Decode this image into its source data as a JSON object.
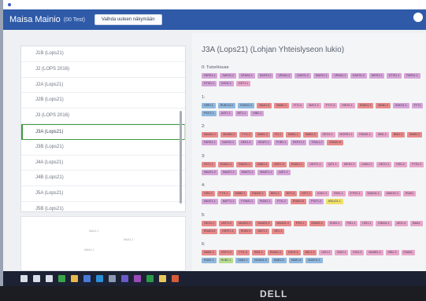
{
  "browser": {
    "url": ""
  },
  "header": {
    "title": "Maisa Mainio",
    "subtitle": "(00 Test)",
    "switch_button": "Vaihda uuteen näkymään"
  },
  "course_list": [
    {
      "label": "J1B (Lops21)",
      "selected": false
    },
    {
      "label": "J2 (LOPS 2016)",
      "selected": false
    },
    {
      "label": "J2A (Lops21)",
      "selected": false
    },
    {
      "label": "J2B (Lops21)",
      "selected": false
    },
    {
      "label": "J3 (LOPS 2016)",
      "selected": false
    },
    {
      "label": "J3A (Lops21)",
      "selected": true
    },
    {
      "label": "J3B (Lops21)",
      "selected": false
    },
    {
      "label": "J4A (Lops21)",
      "selected": false
    },
    {
      "label": "J4B (Lops21)",
      "selected": false
    },
    {
      "label": "J5A (Lops21)",
      "selected": false
    },
    {
      "label": "J5B (Lops21)",
      "selected": false
    }
  ],
  "mini_map": {
    "labels": [
      "MAA1.1",
      "MAA1.1",
      "MAA1.1"
    ]
  },
  "detail": {
    "title": "J3A (Lops21) (Lohjan Yhteislyseon lukio)",
    "groups": [
      {
        "heading": "0: TutorHouse",
        "rows": [
          [
            {
              "code": "FARS1.1",
              "color": "#d6a4d8"
            },
            {
              "code": "SAKS1.2",
              "color": "#d6a4d8"
            },
            {
              "code": "VENA1.1",
              "color": "#d6a4d8"
            },
            {
              "code": "SAKS1.2",
              "color": "#d6a4d8"
            },
            {
              "code": "VENA1.2",
              "color": "#d6a4d8"
            },
            {
              "code": "SAKS1.2",
              "color": "#d6a4d8"
            },
            {
              "code": "SAKS1.1",
              "color": "#d6a4d8"
            },
            {
              "code": "VENA1.1",
              "color": "#d6a4d8"
            },
            {
              "code": "EAKS1.2",
              "color": "#d6a4d8"
            },
            {
              "code": "HIES1.1",
              "color": "#d6a4d8"
            },
            {
              "code": "ETIS1.1",
              "color": "#d6a4d8"
            },
            {
              "code": "FARS1.1",
              "color": "#d6a4d8"
            }
          ],
          [
            {
              "code": "ETIS1.1",
              "color": "#d6a4d8"
            },
            {
              "code": "DOS1.1",
              "color": "#d6a4d8"
            },
            {
              "code": "GET1.1",
              "color": "#e7a6c9"
            }
          ]
        ]
      },
      {
        "heading": "1:",
        "rows": [
          [
            {
              "code": "HIRH.1",
              "color": "#8fb8dd"
            },
            {
              "code": "RUB113.2",
              "color": "#8fb8dd"
            },
            {
              "code": "RUM12.2",
              "color": "#8fb8dd"
            },
            {
              "code": "MAA1.4",
              "color": "#e88a8a"
            },
            {
              "code": "MAB1.1",
              "color": "#e88a8a"
            },
            {
              "code": "FIT1.4",
              "color": "#e7a6c9"
            },
            {
              "code": "MAT1.2",
              "color": "#e7a6c9"
            },
            {
              "code": "FYT1.3",
              "color": "#e7a6c9"
            },
            {
              "code": "HIES1.1",
              "color": "#e7a6c9"
            },
            {
              "code": "ENA01.1",
              "color": "#e88a8a"
            },
            {
              "code": "MAB1.2",
              "color": "#e88a8a"
            },
            {
              "code": "SAKS1.1",
              "color": "#d6a4d8"
            },
            {
              "code": "FYT1",
              "color": "#d6a4d8"
            }
          ],
          [
            {
              "code": "PSI71.1",
              "color": "#8fb8dd"
            },
            {
              "code": "AAT1.1",
              "color": "#d6a4d8"
            },
            {
              "code": "BIT1.1",
              "color": "#d6a4d8"
            },
            {
              "code": "HIB1.1",
              "color": "#d6a4d8"
            }
          ]
        ]
      },
      {
        "heading": "2:",
        "rows": [
          [
            {
              "code": "MAAK1.1",
              "color": "#e88a8a"
            },
            {
              "code": "MAAB1.2",
              "color": "#e88a8a"
            },
            {
              "code": "FYI1.2",
              "color": "#e88a8a"
            },
            {
              "code": "MAB1.2",
              "color": "#e88a8a"
            },
            {
              "code": "FI1.1",
              "color": "#e88a8a"
            },
            {
              "code": "MAB1.1",
              "color": "#e88a8a"
            },
            {
              "code": "MAB1.3",
              "color": "#e88a8a"
            },
            {
              "code": "GEO1.1",
              "color": "#e7a6c9"
            },
            {
              "code": "MORS1.1",
              "color": "#e7a6c9"
            },
            {
              "code": "ENA01.1",
              "color": "#e7a6c9"
            },
            {
              "code": "HIB1.1",
              "color": "#e7a6c9"
            },
            {
              "code": "BIM1.1",
              "color": "#e88a8a"
            },
            {
              "code": "MAB1.2",
              "color": "#e88a8a"
            }
          ],
          [
            {
              "code": "FARS1.1",
              "color": "#d6a4d8"
            },
            {
              "code": "EAKS1.1",
              "color": "#d6a4d8"
            },
            {
              "code": "GEK1.1",
              "color": "#d6a4d8"
            },
            {
              "code": "UEAT1.1",
              "color": "#d6a4d8"
            },
            {
              "code": "FHB1.1",
              "color": "#d6a4d8"
            },
            {
              "code": "KEST1.2",
              "color": "#d6a4d8"
            },
            {
              "code": "TEAL1.2",
              "color": "#d6a4d8"
            },
            {
              "code": "ENA01.6",
              "color": "#e88a8a"
            }
          ]
        ]
      },
      {
        "heading": "3:",
        "rows": [
          [
            {
              "code": "FKT1.1",
              "color": "#e88a8a"
            },
            {
              "code": "ENA01.1",
              "color": "#e88a8a"
            },
            {
              "code": "ENA01.1",
              "color": "#e88a8a"
            },
            {
              "code": "MAB1.4",
              "color": "#e88a8a"
            },
            {
              "code": "MAT1.3",
              "color": "#e88a8a"
            },
            {
              "code": "ENA01.1",
              "color": "#e88a8a"
            },
            {
              "code": "UEST1.1",
              "color": "#e7a6c9"
            },
            {
              "code": "QIT1.1",
              "color": "#e7a6c9"
            },
            {
              "code": "HIES1.1",
              "color": "#e7a6c9"
            },
            {
              "code": "LIAN1.1",
              "color": "#e7a6c9"
            },
            {
              "code": "GEO1.1",
              "color": "#e7a6c9"
            },
            {
              "code": "HIS1.2",
              "color": "#e7a6c9"
            },
            {
              "code": "FYS1.2",
              "color": "#e7a6c9"
            }
          ],
          [
            {
              "code": "MAAY1.2",
              "color": "#d6a4d8"
            },
            {
              "code": "MAAT1.2",
              "color": "#d6a4d8"
            },
            {
              "code": "MAAT1.1",
              "color": "#d6a4d8"
            },
            {
              "code": "MAAT1.1",
              "color": "#d6a4d8"
            },
            {
              "code": "AAT1.1",
              "color": "#d6a4d8"
            }
          ]
        ]
      },
      {
        "heading": "4:",
        "rows": [
          [
            {
              "code": "HIS1.1",
              "color": "#e88a8a"
            },
            {
              "code": "FYI1.1",
              "color": "#e88a8a"
            },
            {
              "code": "MAB0.1",
              "color": "#e88a8a"
            },
            {
              "code": "ENA01.1",
              "color": "#e88a8a"
            },
            {
              "code": "BIA1.1",
              "color": "#e88a8a"
            },
            {
              "code": "BIT1.4",
              "color": "#e88a8a"
            },
            {
              "code": "HIT1.1",
              "color": "#e88a8a"
            },
            {
              "code": "KAK1.1",
              "color": "#e7a6c9"
            },
            {
              "code": "EMI1.1",
              "color": "#e7a6c9"
            },
            {
              "code": "ETIS1.1",
              "color": "#e7a6c9"
            },
            {
              "code": "MAAS1.1",
              "color": "#e7a6c9"
            },
            {
              "code": "MAKS1.1",
              "color": "#e7a6c9"
            },
            {
              "code": "RUM1",
              "color": "#e7a6c9"
            }
          ],
          [
            {
              "code": "MAAT1.1",
              "color": "#d6a4d8"
            },
            {
              "code": "MATT1.1",
              "color": "#d6a4d8"
            },
            {
              "code": "FYAM1.1",
              "color": "#d6a4d8"
            },
            {
              "code": "RUM1.1",
              "color": "#d6a4d8"
            },
            {
              "code": "FYI1.2",
              "color": "#d6a4d8"
            },
            {
              "code": "ENA01.6",
              "color": "#e88a8a"
            },
            {
              "code": "PSI71.2",
              "color": "#d6a4d8"
            },
            {
              "code": "MSUO1.1",
              "color": "#eee06a"
            }
          ]
        ]
      },
      {
        "heading": "5:",
        "rows": [
          [
            {
              "code": "GEO1.1",
              "color": "#e88a8a"
            },
            {
              "code": "UEIT1.2",
              "color": "#e88a8a"
            },
            {
              "code": "MAAS1.2",
              "color": "#e88a8a"
            },
            {
              "code": "MAAS1.2",
              "color": "#e88a8a"
            },
            {
              "code": "MAAS1.4",
              "color": "#e88a8a"
            },
            {
              "code": "PSI1.1",
              "color": "#e88a8a"
            },
            {
              "code": "ENA01.1",
              "color": "#e88a8a"
            },
            {
              "code": "RUB1.1",
              "color": "#e7a6c9"
            },
            {
              "code": "PSI1.1",
              "color": "#e7a6c9"
            },
            {
              "code": "HIS1.1",
              "color": "#e7a6c9"
            },
            {
              "code": "ENA01.1",
              "color": "#e7a6c9"
            },
            {
              "code": "UEI1.4",
              "color": "#e7a6c9"
            },
            {
              "code": "MAA1",
              "color": "#e7a6c9"
            }
          ],
          [
            {
              "code": "ENA01.6",
              "color": "#e88a8a"
            },
            {
              "code": "KEST1.1",
              "color": "#e88a8a"
            },
            {
              "code": "RUB1.5",
              "color": "#e88a8a"
            },
            {
              "code": "AAT1.1",
              "color": "#e88a8a"
            },
            {
              "code": "GE1.1",
              "color": "#e88a8a"
            }
          ]
        ]
      },
      {
        "heading": "6:",
        "rows": [
          [
            {
              "code": "MAB1.1",
              "color": "#e88a8a"
            },
            {
              "code": "GEIT1.2",
              "color": "#e88a8a"
            },
            {
              "code": "FYI1.3",
              "color": "#e88a8a"
            },
            {
              "code": "HIB1.1",
              "color": "#e88a8a"
            },
            {
              "code": "ENA01.1",
              "color": "#e88a8a"
            },
            {
              "code": "KEH1.4",
              "color": "#e88a8a"
            },
            {
              "code": "AEL1.1",
              "color": "#e88a8a"
            },
            {
              "code": "UEI1.2",
              "color": "#e7a6c9"
            },
            {
              "code": "BIU2.1",
              "color": "#e7a6c9"
            },
            {
              "code": "HIS1.2",
              "color": "#e7a6c9"
            },
            {
              "code": "MAAB1.2",
              "color": "#e7a6c9"
            },
            {
              "code": "HIB1.2",
              "color": "#e7a6c9"
            },
            {
              "code": "ENA01",
              "color": "#e7a6c9"
            }
          ],
          [
            {
              "code": "RUB1.1",
              "color": "#8fb8dd"
            },
            {
              "code": "RUB1.1",
              "color": "#b6dd8f"
            },
            {
              "code": "SAB1.1",
              "color": "#8fb8dd"
            },
            {
              "code": "MAAN1.5",
              "color": "#8fb8dd"
            },
            {
              "code": "MAB1.5",
              "color": "#8fb8dd"
            },
            {
              "code": "MAB1.6",
              "color": "#8fb8dd"
            },
            {
              "code": "MAEH1.1",
              "color": "#8fb8dd"
            }
          ]
        ]
      }
    ]
  },
  "taskbar": {
    "icons": [
      {
        "name": "windows-start-icon",
        "color": "#d8dde8"
      },
      {
        "name": "search-icon",
        "color": "#d8dde8"
      },
      {
        "name": "task-view-icon",
        "color": "#d8dde8"
      },
      {
        "name": "chrome-icon",
        "color": "#3aa44a"
      },
      {
        "name": "file-explorer-icon",
        "color": "#e8b84a"
      },
      {
        "name": "mail-icon",
        "color": "#4a7ad8"
      },
      {
        "name": "edge-icon",
        "color": "#2b8fd8"
      },
      {
        "name": "store-icon",
        "color": "#8a9ab4"
      },
      {
        "name": "teams-icon",
        "color": "#6a5ac8"
      },
      {
        "name": "onenote-icon",
        "color": "#9a4ab8"
      },
      {
        "name": "excel-icon",
        "color": "#2a9a4a"
      },
      {
        "name": "folder-icon",
        "color": "#e8c85a"
      },
      {
        "name": "powerpoint-icon",
        "color": "#d85a3a"
      }
    ]
  },
  "monitor": {
    "brand": "DELL"
  }
}
